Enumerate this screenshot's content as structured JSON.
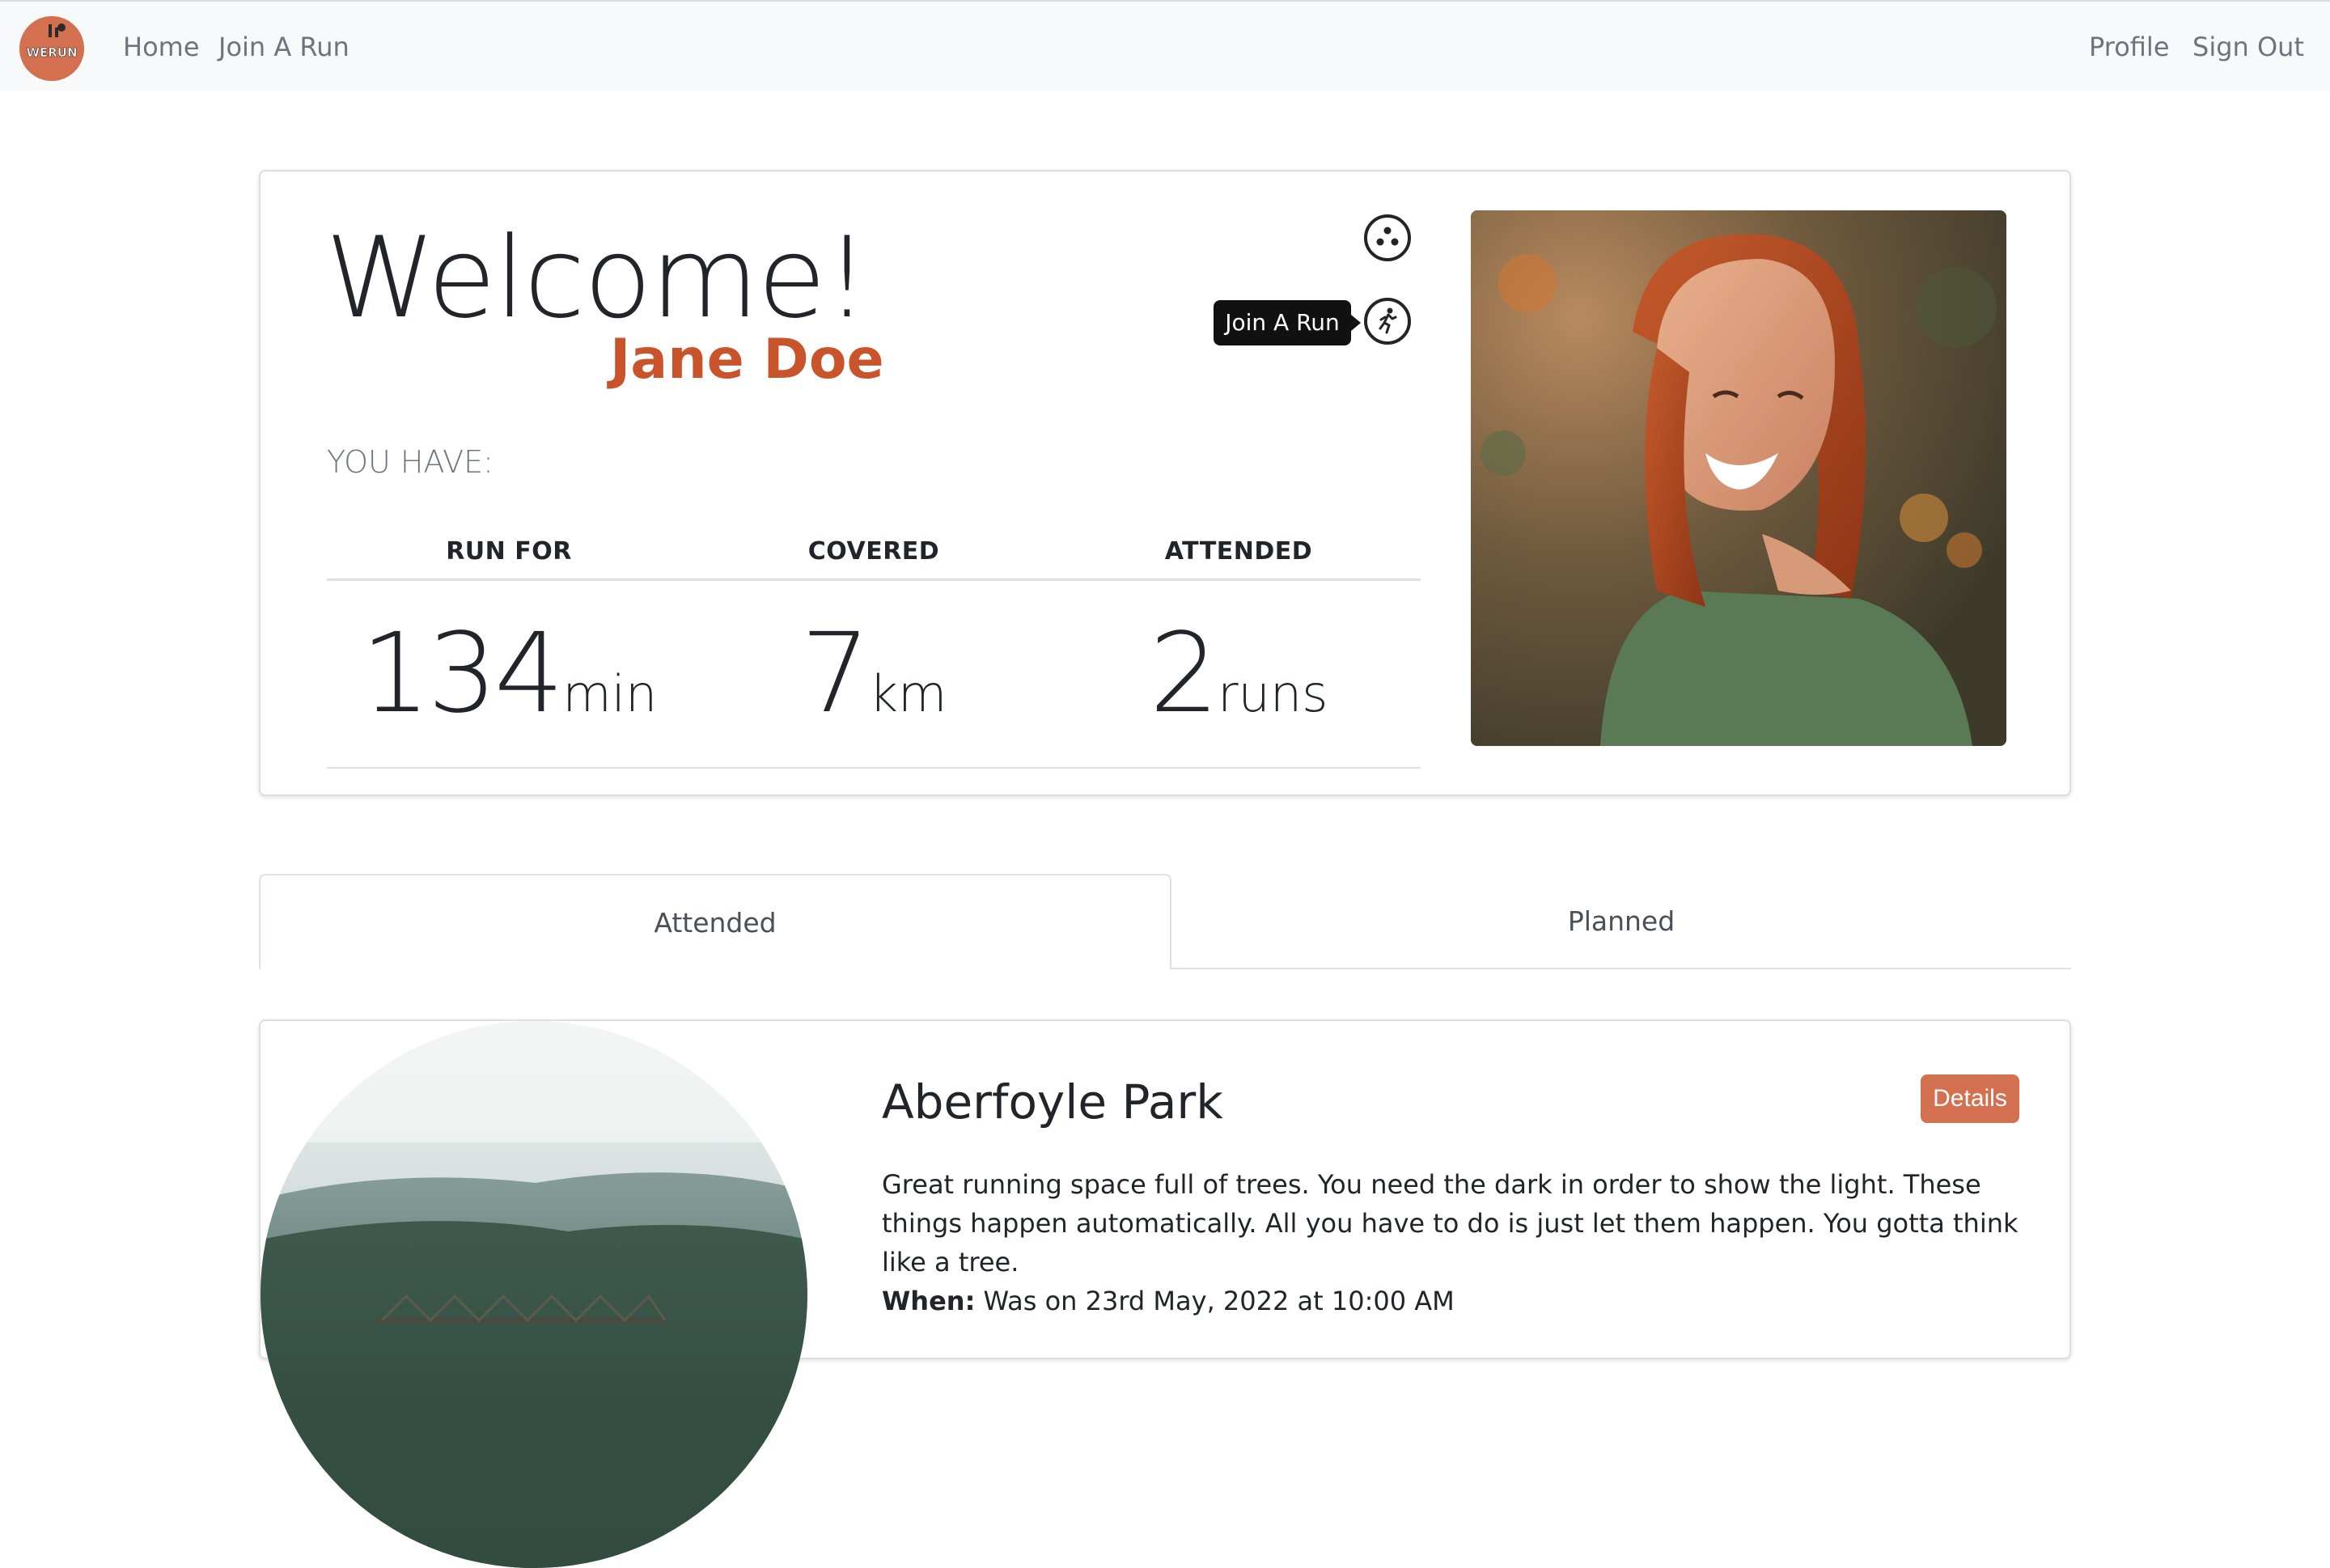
{
  "nav": {
    "logo_text": "WERUN",
    "links": [
      "Home",
      "Join A Run"
    ],
    "right_links": [
      "Profile",
      "Sign Out"
    ]
  },
  "hero": {
    "welcome": "Welcome!",
    "username": "Jane Doe",
    "you_have": "YOU HAVE:",
    "tooltip": "Join A Run",
    "icons": [
      "three-dots-circle-icon",
      "runner-icon"
    ],
    "stats": [
      {
        "label": "RUN FOR",
        "value": "134",
        "unit": "min"
      },
      {
        "label": "COVERED",
        "value": "7",
        "unit": "km"
      },
      {
        "label": "ATTENDED",
        "value": "2",
        "unit": "runs"
      }
    ]
  },
  "tabs": [
    "Attended",
    "Planned"
  ],
  "run": {
    "title": "Aberfoyle Park",
    "details_label": "Details",
    "description": "Great running space full of trees. You need the dark in order to show the light. These things happen automatically. All you have to do is just let them happen. You gotta think like a tree.",
    "when_label": "When:",
    "when_value": "Was on 23rd May, 2022 at 10:00 AM"
  },
  "colors": {
    "accent": "#c9542c",
    "button": "#d3704f",
    "navbar_bg": "#f8f9fa"
  }
}
